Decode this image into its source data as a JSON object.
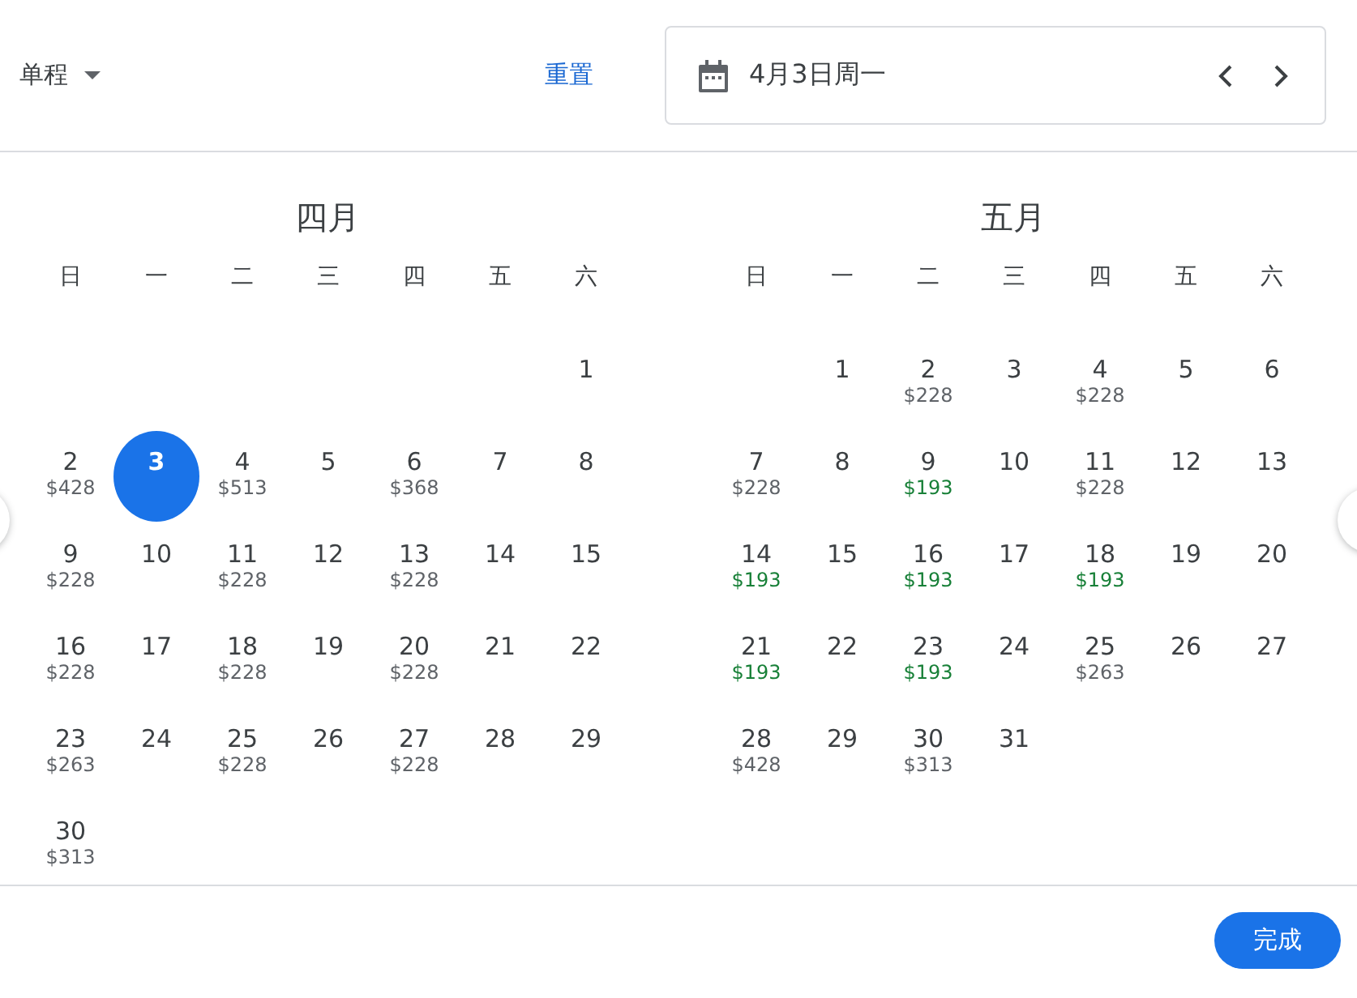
{
  "trip_type": {
    "label": "单程"
  },
  "reset_link": "重置",
  "date_field": {
    "value": "4月3日周一"
  },
  "months": [
    {
      "title": "四月",
      "weekdays": [
        "日",
        "一",
        "二",
        "三",
        "四",
        "五",
        "六"
      ],
      "weeks": [
        [
          {
            "day": "1",
            "selected": false
          }
        ],
        [
          {
            "day": "2",
            "price": "$428",
            "color": "#5f6368",
            "selected": false
          },
          {
            "day": "3",
            "selected": true
          },
          {
            "day": "4",
            "price": "$513",
            "color": "#5f6368",
            "selected": false
          },
          {
            "day": "5",
            "selected": false
          },
          {
            "day": "6",
            "price": "$368",
            "color": "#5f6368",
            "selected": false
          },
          {
            "day": "7",
            "selected": false
          },
          {
            "day": "8",
            "selected": false
          }
        ],
        [
          {
            "day": "9",
            "price": "$228",
            "color": "#5f6368",
            "selected": false
          },
          {
            "day": "10",
            "selected": false
          },
          {
            "day": "11",
            "price": "$228",
            "color": "#5f6368",
            "selected": false
          },
          {
            "day": "12",
            "selected": false
          },
          {
            "day": "13",
            "price": "$228",
            "color": "#5f6368",
            "selected": false
          },
          {
            "day": "14",
            "selected": false
          },
          {
            "day": "15",
            "selected": false
          }
        ],
        [
          {
            "day": "16",
            "price": "$228",
            "color": "#5f6368",
            "selected": false
          },
          {
            "day": "17",
            "selected": false
          },
          {
            "day": "18",
            "price": "$228",
            "color": "#5f6368",
            "selected": false
          },
          {
            "day": "19",
            "selected": false
          },
          {
            "day": "20",
            "price": "$228",
            "color": "#5f6368",
            "selected": false
          },
          {
            "day": "21",
            "selected": false
          },
          {
            "day": "22",
            "selected": false
          }
        ],
        [
          {
            "day": "23",
            "price": "$263",
            "color": "#5f6368",
            "selected": false
          },
          {
            "day": "24",
            "selected": false
          },
          {
            "day": "25",
            "price": "$228",
            "color": "#5f6368",
            "selected": false
          },
          {
            "day": "26",
            "selected": false
          },
          {
            "day": "27",
            "price": "$228",
            "color": "#5f6368",
            "selected": false
          },
          {
            "day": "28",
            "selected": false
          },
          {
            "day": "29",
            "selected": false
          }
        ],
        [
          {
            "day": "30",
            "price": "$313",
            "color": "#5f6368",
            "selected": false
          }
        ]
      ]
    },
    {
      "title": "五月",
      "weekdays": [
        "日",
        "一",
        "二",
        "三",
        "四",
        "五",
        "六"
      ],
      "weeks": [
        [
          {
            "day": "1",
            "selected": false
          },
          {
            "day": "2",
            "price": "$228",
            "color": "#5f6368",
            "selected": false
          },
          {
            "day": "3",
            "selected": false
          },
          {
            "day": "4",
            "price": "$228",
            "color": "#5f6368",
            "selected": false
          },
          {
            "day": "5",
            "selected": false
          },
          {
            "day": "6",
            "selected": false
          }
        ],
        [
          {
            "day": "7",
            "price": "$228",
            "color": "#5f6368",
            "selected": false
          },
          {
            "day": "8",
            "selected": false
          },
          {
            "day": "9",
            "price": "$193",
            "color": "#188038",
            "selected": false
          },
          {
            "day": "10",
            "selected": false
          },
          {
            "day": "11",
            "price": "$228",
            "color": "#5f6368",
            "selected": false
          },
          {
            "day": "12",
            "selected": false
          },
          {
            "day": "13",
            "selected": false
          }
        ],
        [
          {
            "day": "14",
            "price": "$193",
            "color": "#188038",
            "selected": false
          },
          {
            "day": "15",
            "selected": false
          },
          {
            "day": "16",
            "price": "$193",
            "color": "#188038",
            "selected": false
          },
          {
            "day": "17",
            "selected": false
          },
          {
            "day": "18",
            "price": "$193",
            "color": "#188038",
            "selected": false
          },
          {
            "day": "19",
            "selected": false
          },
          {
            "day": "20",
            "selected": false
          }
        ],
        [
          {
            "day": "21",
            "price": "$193",
            "color": "#188038",
            "selected": false
          },
          {
            "day": "22",
            "selected": false
          },
          {
            "day": "23",
            "price": "$193",
            "color": "#188038",
            "selected": false
          },
          {
            "day": "24",
            "selected": false
          },
          {
            "day": "25",
            "price": "$263",
            "color": "#5f6368",
            "selected": false
          },
          {
            "day": "26",
            "selected": false
          },
          {
            "day": "27",
            "selected": false
          }
        ],
        [
          {
            "day": "28",
            "price": "$428",
            "color": "#5f6368",
            "selected": false
          },
          {
            "day": "29",
            "selected": false
          },
          {
            "day": "30",
            "price": "$313",
            "color": "#5f6368",
            "selected": false
          },
          {
            "day": "31",
            "selected": false
          }
        ]
      ]
    }
  ],
  "done_button": "完成"
}
